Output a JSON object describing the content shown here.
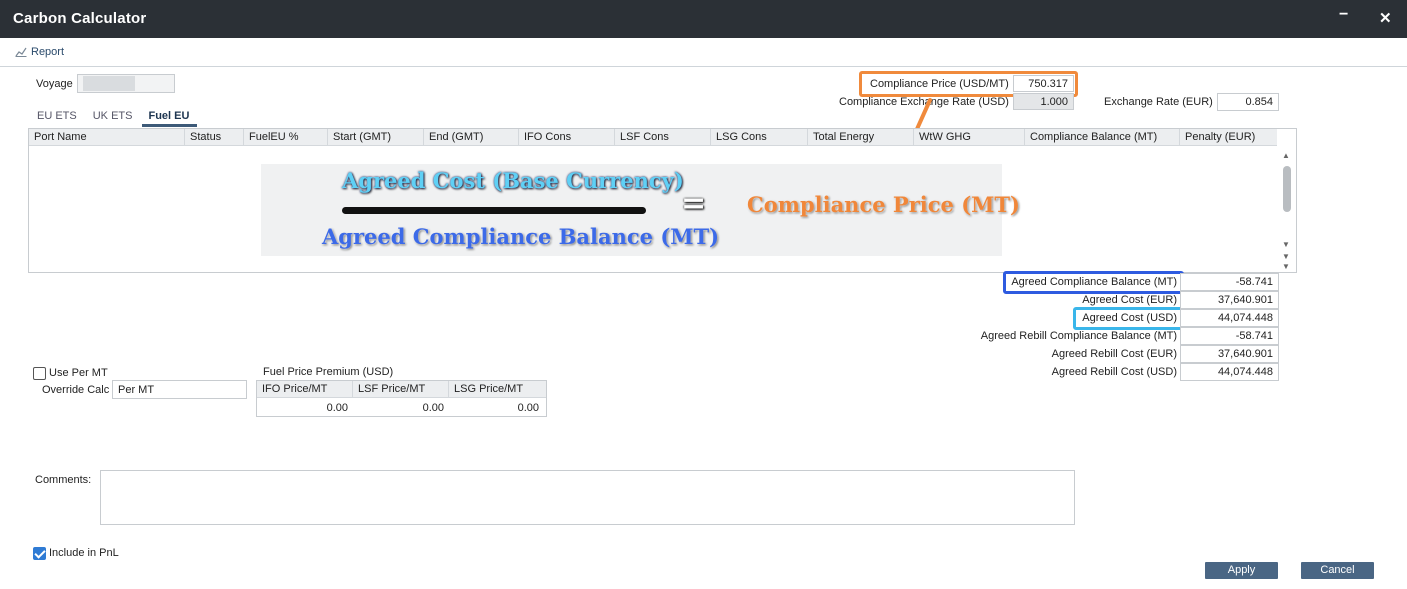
{
  "window": {
    "title": "Carbon Calculator",
    "minimize_glyph": "−",
    "close_glyph": "✕"
  },
  "toolbar": {
    "report_label": "Report",
    "report_icon": "chart-icon"
  },
  "voyage": {
    "label": "Voyage",
    "value": ""
  },
  "compliance": {
    "price_label": "Compliance Price (USD/MT)",
    "price_value": "750.317",
    "exchange_rate_usd_label": "Compliance Exchange Rate (USD)",
    "exchange_rate_usd_value": "1.000",
    "exchange_rate_eur_label": "Exchange Rate (EUR)",
    "exchange_rate_eur_value": "0.854"
  },
  "tabs": [
    {
      "label": "EU ETS",
      "active": false
    },
    {
      "label": "UK ETS",
      "active": false
    },
    {
      "label": "Fuel EU",
      "active": true
    }
  ],
  "grid": {
    "columns": [
      "Port Name",
      "Status",
      "FuelEU %",
      "Start (GMT)",
      "End (GMT)",
      "IFO Cons",
      "LSF Cons",
      "LSG Cons",
      "Total Energy",
      "WtW GHG",
      "Compliance Balance (MT)",
      "Penalty (EUR)"
    ]
  },
  "formula": {
    "numerator": "Agreed Cost (Base Currency)",
    "denominator": "Agreed Compliance Balance (MT)",
    "equals": "=",
    "result": "Compliance Price (MT)"
  },
  "summary": [
    {
      "label": "Agreed Compliance Balance (MT)",
      "value": "-58.741"
    },
    {
      "label": "Agreed Cost (EUR)",
      "value": "37,640.901"
    },
    {
      "label": "Agreed Cost (USD)",
      "value": "44,074.448"
    },
    {
      "label": "Agreed Rebill Compliance Balance (MT)",
      "value": "-58.741"
    },
    {
      "label": "Agreed Rebill Cost (EUR)",
      "value": "37,640.901"
    },
    {
      "label": "Agreed Rebill Cost (USD)",
      "value": "44,074.448"
    }
  ],
  "use_per_mt": {
    "label": "Use Per MT",
    "checked": false
  },
  "override": {
    "label": "Override Calc",
    "value": "Per MT"
  },
  "fuel_price_premium": {
    "title": "Fuel Price Premium (USD)",
    "columns": [
      "IFO Price/MT",
      "LSF Price/MT",
      "LSG Price/MT"
    ],
    "values": [
      "0.00",
      "0.00",
      "0.00"
    ]
  },
  "comments": {
    "label": "Comments:",
    "value": ""
  },
  "include_pnl": {
    "label": "Include in PnL",
    "checked": true
  },
  "buttons": {
    "apply": "Apply",
    "cancel": "Cancel"
  },
  "colors": {
    "titlebar": "#2b3036",
    "button": "#4a6684",
    "highlight_orange": "#f08a3c",
    "highlight_blue": "#2e5be0",
    "highlight_cyan": "#3ab6ea"
  }
}
